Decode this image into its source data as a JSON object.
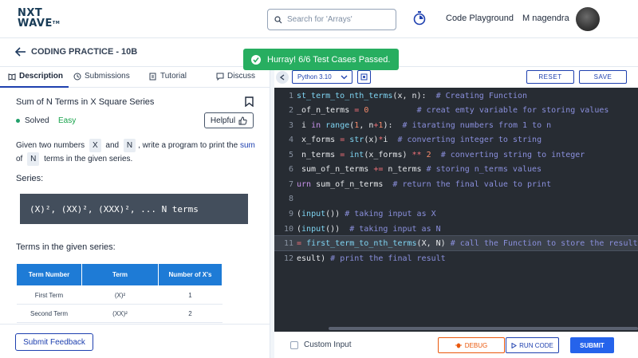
{
  "nav": {
    "logo_line1": "NXT",
    "logo_line2": "WAVE",
    "logo_tm": "TM",
    "search_placeholder": "Search for 'Arrays'",
    "code_playground": "Code Playground",
    "user_name": "M nagendra"
  },
  "header": {
    "title": "CODING PRACTICE - 10B"
  },
  "toast": {
    "text": "Hurray! 6/6 Test Cases Passed."
  },
  "tabs": [
    {
      "label": "Description"
    },
    {
      "label": "Submissions"
    },
    {
      "label": "Tutorial"
    },
    {
      "label": "Discuss"
    }
  ],
  "question": {
    "title": "Sum of N Terms in X Square Series",
    "status": "Solved",
    "difficulty": "Easy",
    "helpful_label": "Helpful",
    "desc_given": "Given two numbers",
    "desc_x": "X",
    "desc_and": "and",
    "desc_n": "N",
    "desc_write": ", write a program to print the",
    "desc_sum": "sum",
    "desc_of": "of",
    "desc_n2": "N",
    "desc_tail": "terms in the given series.",
    "series_label": "Series:",
    "series_text": "(X)², (XX)², (XXX)², ... N terms",
    "terms_label": "Terms in the given series:",
    "table_headers": [
      "Term Number",
      "Term",
      "Number of X's"
    ],
    "table_rows": [
      [
        "First Term",
        "(X)²",
        "1"
      ],
      [
        "Second Term",
        "(XX)²",
        "2"
      ]
    ],
    "feedback_label": "Submit Feedback"
  },
  "editor": {
    "language": "Python 3.10",
    "reset_label": "RESET",
    "save_label": "SAVE",
    "lines": [
      "1",
      "2",
      "3",
      "4",
      "5",
      "6",
      "7",
      "8",
      "9",
      "10",
      "11",
      "12"
    ],
    "custom_input_label": "Custom Input",
    "debug_label": "DEBUG",
    "run_label": "RUN CODE",
    "submit_label": "SUBMIT"
  },
  "colors": {
    "accent": "#1e40af",
    "success": "#27ae60",
    "editor_bg": "#272c33",
    "table_header": "#1e7bd6"
  }
}
